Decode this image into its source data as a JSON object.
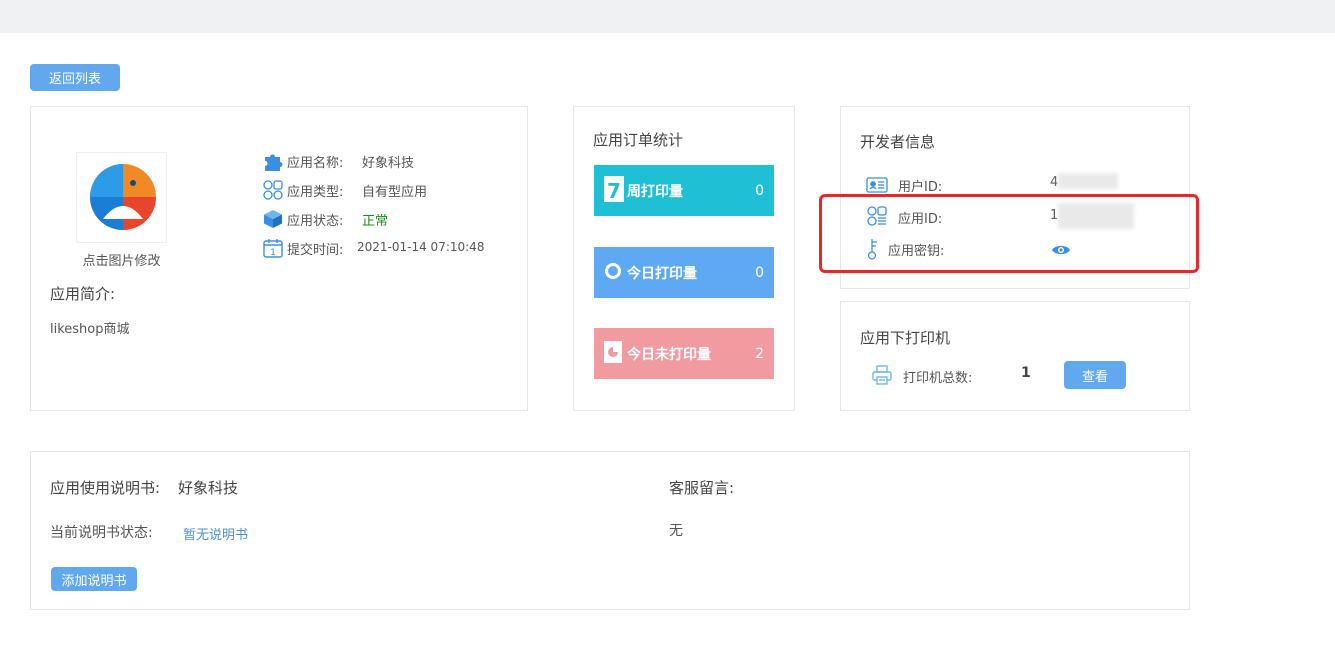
{
  "toolbar": {
    "back_label": "返回列表"
  },
  "app_info": {
    "logo_caption": "点击图片修改",
    "name_label": "应用名称:",
    "name_value": "好象科技",
    "type_label": "应用类型:",
    "type_value": "自有型应用",
    "status_label": "应用状态:",
    "status_value": "正常",
    "submit_label": "提交时间:",
    "submit_value": "2021-01-14 07:10:48",
    "intro_label": "应用简介:",
    "intro_value": "likeshop商城",
    "status_color": "#1a8a1a"
  },
  "order_stats": {
    "title": "应用订单统计",
    "items": [
      {
        "label": "周打印量",
        "value": "0",
        "color": "#1fbfd6",
        "icon": "calendar-7-icon"
      },
      {
        "label": "今日打印量",
        "value": "0",
        "color": "#5ea9f2",
        "icon": "dot-icon"
      },
      {
        "label": "今日未打印量",
        "value": "2",
        "color": "#f19aa0",
        "icon": "pie-icon"
      }
    ]
  },
  "developer": {
    "title": "开发者信息",
    "user_id_label": "用户ID:",
    "user_id_value": "4",
    "app_id_label": "应用ID:",
    "app_id_value": "1",
    "secret_label": "应用密钥:"
  },
  "printers": {
    "title": "应用下打印机",
    "total_label": "打印机总数:",
    "total_value": "1",
    "view_label": "查看"
  },
  "manual": {
    "title_label": "应用使用说明书:",
    "title_value": "好象科技",
    "status_label": "当前说明书状态:",
    "status_value": "暂无说明书",
    "add_label": "添加说明书",
    "service_label": "客服留言:",
    "service_value": "无",
    "link_color": "#4a90d9"
  }
}
